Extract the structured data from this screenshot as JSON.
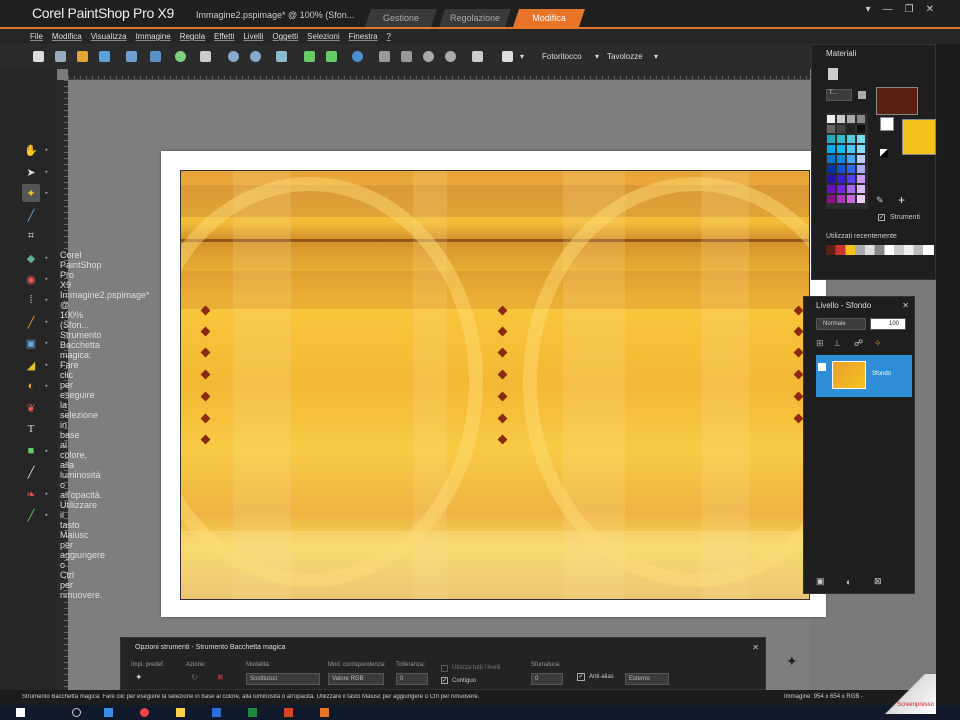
{
  "titlebar": {
    "logo": "Corel PaintShop Pro X9",
    "document": "Immagine2.pspimage* @ 100% (Sfon...",
    "workspace_tabs": [
      {
        "label": "Gestione",
        "active": false
      },
      {
        "label": "Regolazione",
        "active": false
      },
      {
        "label": "Modifica",
        "active": true
      }
    ]
  },
  "menu": [
    "File",
    "Modifica",
    "Visualizza",
    "Immagine",
    "Regola",
    "Effetti",
    "Livelli",
    "Oggetti",
    "Selezioni",
    "Finestra",
    "?"
  ],
  "toolbar": {
    "fotoritocco": "Fotoritocco",
    "tavolozze": "Tavolozze"
  },
  "materials": {
    "title": "Materiali",
    "type_select": "T...",
    "foreground_color": "#5a2010",
    "background_color": "#f5c21d",
    "strumenti_label": "Strumenti",
    "recenti_label": "Utilizzati recentemente"
  },
  "layers": {
    "title": "Livello - Sfondo",
    "blend_mode": "Normale",
    "opacity": "100",
    "layer_name": "Sfondo"
  },
  "tool_options": {
    "title": "Opzioni strumenti - Strumento Bacchetta magica",
    "labels": {
      "presets": "Impi. predef.",
      "action": "Azione:",
      "mode": "Modalità:",
      "match_mode": "Mod. corrispondenza:",
      "tolerance": "Tolleranza:",
      "use_all_layers": "Utilizza tutti i livelli",
      "contiguous": "Contiguo",
      "feather": "Sfumatura:",
      "antialias": "Anti-alias",
      "antialias_mode": "Esterno"
    },
    "values": {
      "mode": "Sostituisci",
      "match_mode": "Valore RGB",
      "tolerance": "0",
      "feather": "0"
    }
  },
  "status": {
    "message": "Strumento Bacchetta magica: Fare clic per eseguire la selezione in base al colore, alla luminosità o all'opacità. Utilizzare il tasto Maiusc per aggiungere o Ctrl per rimuovere.",
    "image_info": "Immagine: 954 x 654 x RGB -"
  },
  "watermark": "Screenpresso"
}
